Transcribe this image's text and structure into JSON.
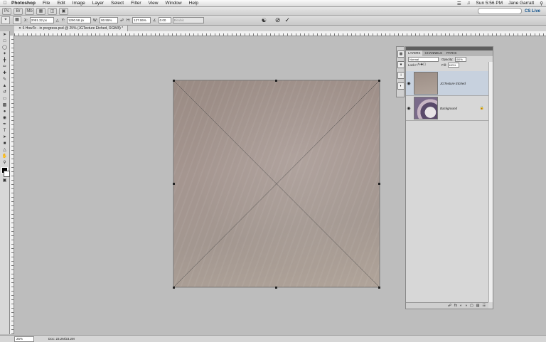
{
  "menubar": {
    "app_name": "Photoshop",
    "menus": [
      "File",
      "Edit",
      "Image",
      "Layer",
      "Select",
      "Filter",
      "View",
      "Window",
      "Help"
    ],
    "clock": "Sun 5:56 PM",
    "user": "Jane Garratt"
  },
  "appbar": {
    "workspace_label": "CS Live"
  },
  "options": {
    "x_label": "X:",
    "x_value": "2051.32 px",
    "y_label": "Y:",
    "y_value": "1290.58 px",
    "w_label": "W:",
    "w_value": "80.55%",
    "h_label": "H:",
    "h_value": "127.06%",
    "angle_value": "0.00",
    "interp_value": "Bicubic"
  },
  "document": {
    "tab_title": "6 HowTo - in progress.psd @ 25% (JGTexture Etched, RGB/8) *"
  },
  "layers_panel": {
    "tabs": [
      "LAYERS",
      "CHANNELS",
      "PATHS"
    ],
    "blend_mode": "Normal",
    "opacity_label": "Opacity:",
    "opacity_value": "100%",
    "lock_label": "Lock:",
    "fill_label": "Fill:",
    "fill_value": "100%",
    "layers": [
      {
        "name": "JGTexture Etched",
        "selected": true
      },
      {
        "name": "Background",
        "selected": false
      }
    ]
  },
  "status": {
    "zoom": "25%",
    "doc_info": "Doc: 23.2M/23.2M"
  }
}
